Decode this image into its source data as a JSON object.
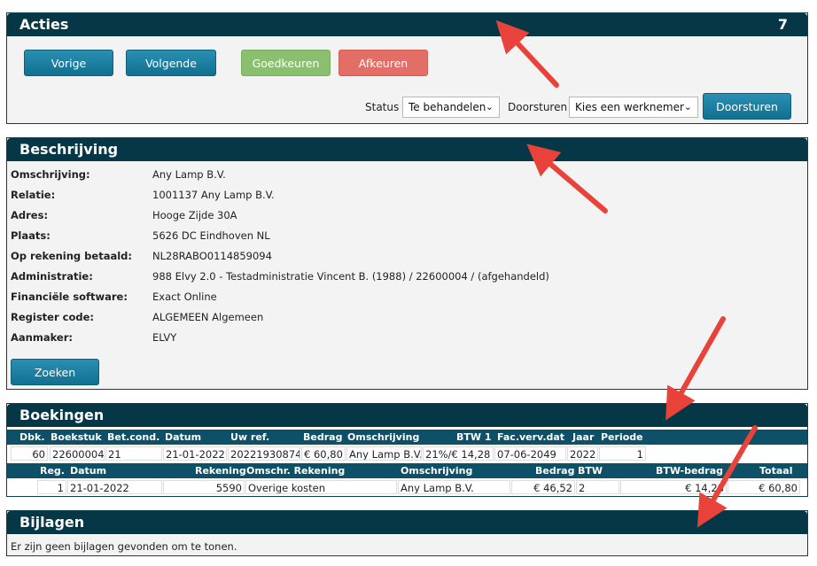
{
  "acties": {
    "title": "Acties",
    "count": "7",
    "buttons": {
      "prev": "Vorige",
      "next": "Volgende",
      "approve": "Goedkeuren",
      "reject": "Afkeuren",
      "forward": "Doorsturen"
    },
    "status_label": "Status",
    "status_value": "Te behandelen",
    "forward_label": "Doorsturen",
    "forward_value": "Kies een werknemer"
  },
  "beschrijving": {
    "title": "Beschrijving",
    "rows": [
      {
        "label": "Omschrijving:",
        "value": "Any Lamp B.V."
      },
      {
        "label": "Relatie:",
        "value": "1001137 Any Lamp B.V."
      },
      {
        "label": "Adres:",
        "value": "Hooge Zijde 30A"
      },
      {
        "label": "Plaats:",
        "value": "5626 DC Eindhoven NL"
      },
      {
        "label": "Op rekening betaald:",
        "value": "NL28RABO0114859094"
      },
      {
        "label": "Administratie:",
        "value": "988 Elvy 2.0 - Testadministratie Vincent B. (1988) / 22600004 / (afgehandeld)"
      },
      {
        "label": "Financiële software:",
        "value": "Exact Online"
      },
      {
        "label": "Register code:",
        "value": "ALGEMEEN Algemeen"
      },
      {
        "label": "Aanmaker:",
        "value": "ELVY"
      }
    ],
    "search_button": "Zoeken"
  },
  "boekingen": {
    "title": "Boekingen",
    "headers": [
      "Dbk.",
      "Boekstuk",
      "Bet.cond.",
      "Datum",
      "Uw ref.",
      "Bedrag",
      "Omschrijving",
      "BTW 1",
      "Fac.verv.dat",
      "Jaar",
      "Periode"
    ],
    "row": [
      "60",
      "22600004",
      "21",
      "21-01-2022",
      "20221930874",
      "€ 60,80",
      "Any Lamp B.V.",
      "21%/€ 14,28",
      "07-06-2049",
      "2022",
      "1"
    ],
    "line_headers": [
      "Reg.",
      "Datum",
      "Rekening",
      "Omschr. Rekening",
      "Omschrijving",
      "Bedrag",
      "BTW",
      "BTW-bedrag",
      "Totaal"
    ],
    "line_row": [
      "1",
      "21-01-2022",
      "5590",
      "Overige kosten",
      "Any Lamp B.V.",
      "€ 46,52",
      "2",
      "€ 14,28",
      "€ 60,80"
    ]
  },
  "bijlagen": {
    "title": "Bijlagen",
    "message": "Er zijn geen bijlagen gevonden om te tonen."
  },
  "colors": {
    "header": "#053746",
    "blue_button": "#12708f",
    "green_button": "#8abf70",
    "red_button": "#e36e66",
    "arrow": "#e8423a"
  }
}
